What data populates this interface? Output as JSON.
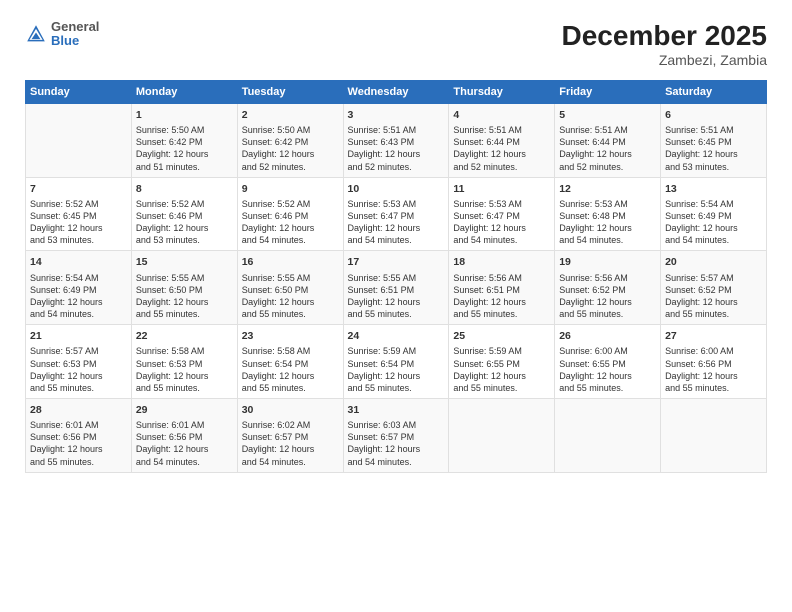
{
  "logo": {
    "general": "General",
    "blue": "Blue"
  },
  "title": "December 2025",
  "location": "Zambezi, Zambia",
  "days_header": [
    "Sunday",
    "Monday",
    "Tuesday",
    "Wednesday",
    "Thursday",
    "Friday",
    "Saturday"
  ],
  "weeks": [
    [
      {
        "day": "",
        "info": ""
      },
      {
        "day": "1",
        "info": "Sunrise: 5:50 AM\nSunset: 6:42 PM\nDaylight: 12 hours\nand 51 minutes."
      },
      {
        "day": "2",
        "info": "Sunrise: 5:50 AM\nSunset: 6:42 PM\nDaylight: 12 hours\nand 52 minutes."
      },
      {
        "day": "3",
        "info": "Sunrise: 5:51 AM\nSunset: 6:43 PM\nDaylight: 12 hours\nand 52 minutes."
      },
      {
        "day": "4",
        "info": "Sunrise: 5:51 AM\nSunset: 6:44 PM\nDaylight: 12 hours\nand 52 minutes."
      },
      {
        "day": "5",
        "info": "Sunrise: 5:51 AM\nSunset: 6:44 PM\nDaylight: 12 hours\nand 52 minutes."
      },
      {
        "day": "6",
        "info": "Sunrise: 5:51 AM\nSunset: 6:45 PM\nDaylight: 12 hours\nand 53 minutes."
      }
    ],
    [
      {
        "day": "7",
        "info": "Sunrise: 5:52 AM\nSunset: 6:45 PM\nDaylight: 12 hours\nand 53 minutes."
      },
      {
        "day": "8",
        "info": "Sunrise: 5:52 AM\nSunset: 6:46 PM\nDaylight: 12 hours\nand 53 minutes."
      },
      {
        "day": "9",
        "info": "Sunrise: 5:52 AM\nSunset: 6:46 PM\nDaylight: 12 hours\nand 54 minutes."
      },
      {
        "day": "10",
        "info": "Sunrise: 5:53 AM\nSunset: 6:47 PM\nDaylight: 12 hours\nand 54 minutes."
      },
      {
        "day": "11",
        "info": "Sunrise: 5:53 AM\nSunset: 6:47 PM\nDaylight: 12 hours\nand 54 minutes."
      },
      {
        "day": "12",
        "info": "Sunrise: 5:53 AM\nSunset: 6:48 PM\nDaylight: 12 hours\nand 54 minutes."
      },
      {
        "day": "13",
        "info": "Sunrise: 5:54 AM\nSunset: 6:49 PM\nDaylight: 12 hours\nand 54 minutes."
      }
    ],
    [
      {
        "day": "14",
        "info": "Sunrise: 5:54 AM\nSunset: 6:49 PM\nDaylight: 12 hours\nand 54 minutes."
      },
      {
        "day": "15",
        "info": "Sunrise: 5:55 AM\nSunset: 6:50 PM\nDaylight: 12 hours\nand 55 minutes."
      },
      {
        "day": "16",
        "info": "Sunrise: 5:55 AM\nSunset: 6:50 PM\nDaylight: 12 hours\nand 55 minutes."
      },
      {
        "day": "17",
        "info": "Sunrise: 5:55 AM\nSunset: 6:51 PM\nDaylight: 12 hours\nand 55 minutes."
      },
      {
        "day": "18",
        "info": "Sunrise: 5:56 AM\nSunset: 6:51 PM\nDaylight: 12 hours\nand 55 minutes."
      },
      {
        "day": "19",
        "info": "Sunrise: 5:56 AM\nSunset: 6:52 PM\nDaylight: 12 hours\nand 55 minutes."
      },
      {
        "day": "20",
        "info": "Sunrise: 5:57 AM\nSunset: 6:52 PM\nDaylight: 12 hours\nand 55 minutes."
      }
    ],
    [
      {
        "day": "21",
        "info": "Sunrise: 5:57 AM\nSunset: 6:53 PM\nDaylight: 12 hours\nand 55 minutes."
      },
      {
        "day": "22",
        "info": "Sunrise: 5:58 AM\nSunset: 6:53 PM\nDaylight: 12 hours\nand 55 minutes."
      },
      {
        "day": "23",
        "info": "Sunrise: 5:58 AM\nSunset: 6:54 PM\nDaylight: 12 hours\nand 55 minutes."
      },
      {
        "day": "24",
        "info": "Sunrise: 5:59 AM\nSunset: 6:54 PM\nDaylight: 12 hours\nand 55 minutes."
      },
      {
        "day": "25",
        "info": "Sunrise: 5:59 AM\nSunset: 6:55 PM\nDaylight: 12 hours\nand 55 minutes."
      },
      {
        "day": "26",
        "info": "Sunrise: 6:00 AM\nSunset: 6:55 PM\nDaylight: 12 hours\nand 55 minutes."
      },
      {
        "day": "27",
        "info": "Sunrise: 6:00 AM\nSunset: 6:56 PM\nDaylight: 12 hours\nand 55 minutes."
      }
    ],
    [
      {
        "day": "28",
        "info": "Sunrise: 6:01 AM\nSunset: 6:56 PM\nDaylight: 12 hours\nand 55 minutes."
      },
      {
        "day": "29",
        "info": "Sunrise: 6:01 AM\nSunset: 6:56 PM\nDaylight: 12 hours\nand 54 minutes."
      },
      {
        "day": "30",
        "info": "Sunrise: 6:02 AM\nSunset: 6:57 PM\nDaylight: 12 hours\nand 54 minutes."
      },
      {
        "day": "31",
        "info": "Sunrise: 6:03 AM\nSunset: 6:57 PM\nDaylight: 12 hours\nand 54 minutes."
      },
      {
        "day": "",
        "info": ""
      },
      {
        "day": "",
        "info": ""
      },
      {
        "day": "",
        "info": ""
      }
    ]
  ]
}
